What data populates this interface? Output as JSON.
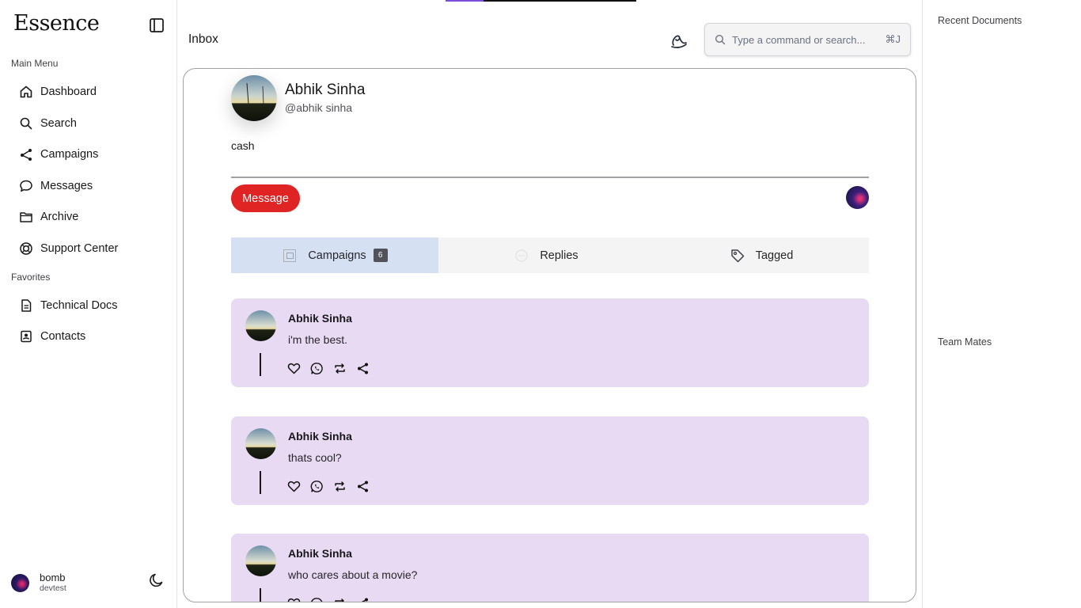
{
  "app": {
    "logo_text": "Essence"
  },
  "sidebar": {
    "main_menu_label": "Main Menu",
    "main_items": [
      {
        "label": "Dashboard",
        "icon": "home-icon"
      },
      {
        "label": "Search",
        "icon": "search-icon"
      },
      {
        "label": "Campaigns",
        "icon": "share-nodes-icon"
      },
      {
        "label": "Messages",
        "icon": "chat-bubble-icon"
      },
      {
        "label": "Archive",
        "icon": "folder-icon"
      },
      {
        "label": "Support Center",
        "icon": "lifebuoy-icon"
      }
    ],
    "favorites_label": "Favorites",
    "favorite_items": [
      {
        "label": "Technical Docs",
        "icon": "document-icon"
      },
      {
        "label": "Contacts",
        "icon": "contact-card-icon"
      }
    ],
    "user": {
      "name": "bomb",
      "subtitle": "devtest"
    }
  },
  "header": {
    "title": "Inbox",
    "progress": 0.2,
    "command_placeholder": "Type a command or search...",
    "shortcut": "⌘J"
  },
  "profile": {
    "name": "Abhik Sinha",
    "handle": "@abhik sinha",
    "bio": "cash",
    "message_button": "Message"
  },
  "tabs": [
    {
      "label": "Campaigns",
      "count": "6",
      "active": true
    },
    {
      "label": "Replies",
      "active": false
    },
    {
      "label": "Tagged",
      "active": false
    }
  ],
  "posts": [
    {
      "author": "Abhik Sinha",
      "text": "i'm the best."
    },
    {
      "author": "Abhik Sinha",
      "text": "thats cool?"
    },
    {
      "author": "Abhik Sinha",
      "text": "who cares about a movie?"
    }
  ],
  "right_column": {
    "recent_documents_label": "Recent Documents",
    "team_mates_label": "Team Mates"
  },
  "colors": {
    "accent_red": "#e02424",
    "post_background": "#e8daf3",
    "active_tab": "#d6e0f3",
    "progress_fill": "#7c4ddb"
  }
}
